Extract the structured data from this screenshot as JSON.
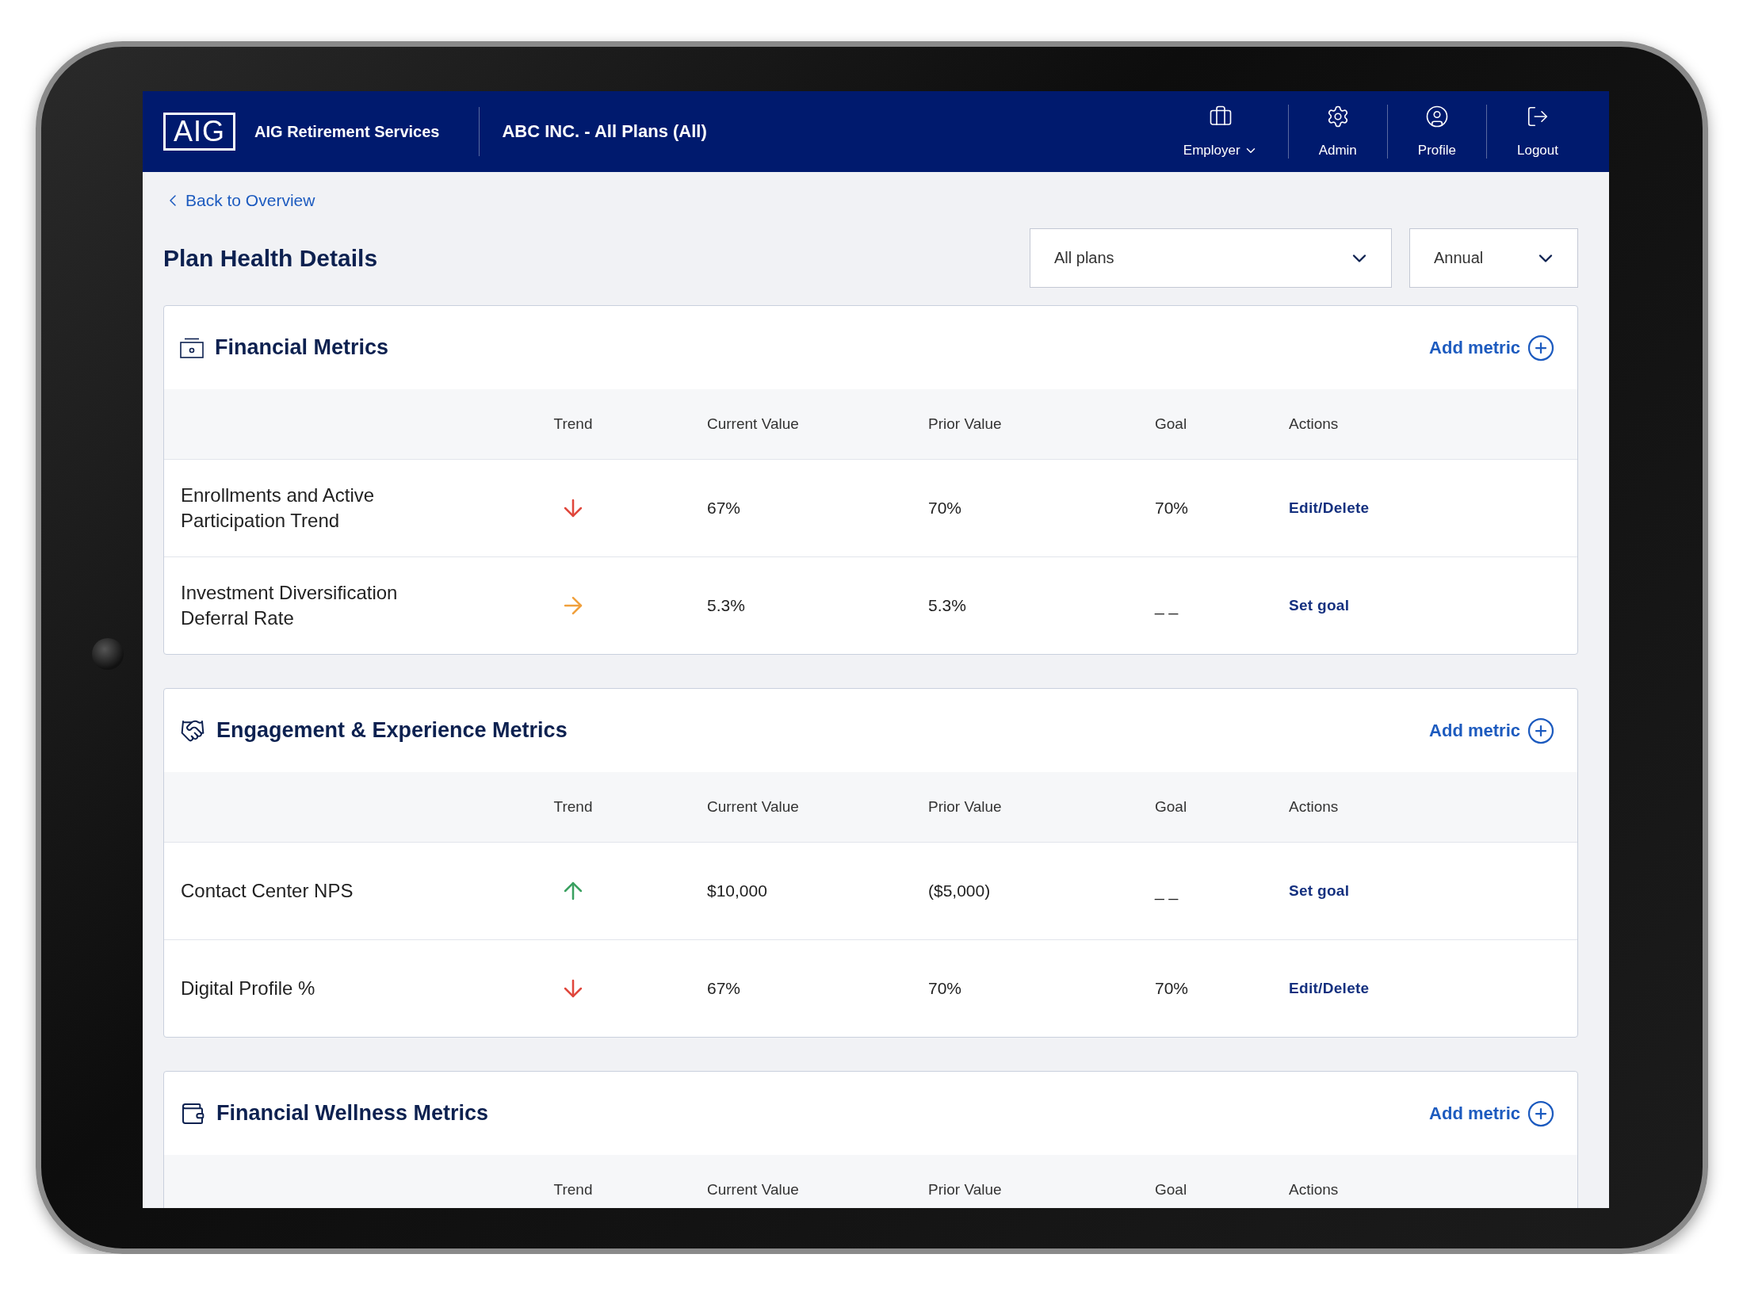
{
  "app": {
    "logo": "AIG",
    "name": "AIG Retirement Services",
    "context": "ABC INC. - All Plans (All)"
  },
  "nav": [
    {
      "label": "Employer",
      "has_menu": true
    },
    {
      "label": "Admin",
      "has_menu": false
    },
    {
      "label": "Profile",
      "has_menu": false
    },
    {
      "label": "Logout",
      "has_menu": false
    }
  ],
  "back_link": "Back to Overview",
  "page_title": "Plan Health Details",
  "filters": [
    {
      "value": "All plans"
    },
    {
      "value": "Annual"
    }
  ],
  "sections": [
    {
      "title": "Financial Metrics",
      "add_label": "Add metric",
      "columns": [
        "Trend",
        "Current Value",
        "Prior Value",
        "Goal",
        "Actions"
      ],
      "rows": [
        {
          "name": "Enrollments and Active Participation Trend",
          "kind": "down",
          "current": "67%",
          "prior": "70%",
          "goal": "70%",
          "action": "Edit/Delete"
        },
        {
          "name": "Investment Diversification Deferral Rate",
          "kind": "flat",
          "current": "5.3%",
          "prior": "5.3%",
          "goal": "_ _",
          "action": "Set goal"
        }
      ]
    },
    {
      "title": "Engagement & Experience Metrics",
      "add_label": "Add metric",
      "columns": [
        "Trend",
        "Current Value",
        "Prior Value",
        "Goal",
        "Actions"
      ],
      "rows": [
        {
          "name": "Contact Center NPS",
          "kind": "up",
          "current": "$10,000",
          "prior": "($5,000)",
          "goal": "_ _",
          "action": "Set goal"
        },
        {
          "name": "Digital Profile %",
          "kind": "down",
          "current": "67%",
          "prior": "70%",
          "goal": "70%",
          "action": "Edit/Delete"
        }
      ]
    },
    {
      "title": "Financial Wellness Metrics",
      "add_label": "Add metric",
      "columns": [
        "Trend",
        "Current Value",
        "Prior Value",
        "Goal",
        "Actions"
      ]
    }
  ]
}
